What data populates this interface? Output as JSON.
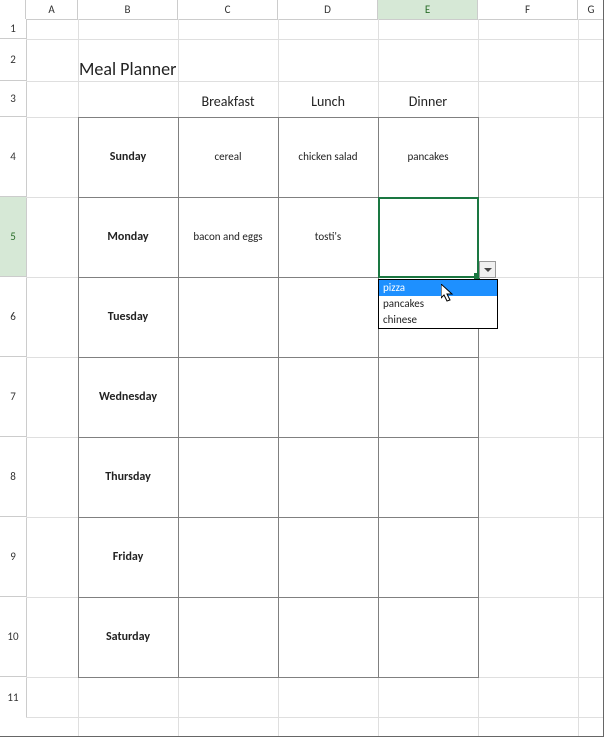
{
  "columns": {
    "A": {
      "label": "A",
      "width": 52
    },
    "B": {
      "label": "B",
      "width": 100
    },
    "C": {
      "label": "C",
      "width": 100
    },
    "D": {
      "label": "D",
      "width": 100
    },
    "E": {
      "label": "E",
      "width": 100
    },
    "F": {
      "label": "F",
      "width": 100
    },
    "G": {
      "label": "G",
      "width": 26
    }
  },
  "rows": {
    "1": 20,
    "2": 42,
    "3": 36,
    "4": 80,
    "5": 80,
    "6": 80,
    "7": 80,
    "8": 80,
    "9": 80,
    "10": 80,
    "11": 40
  },
  "title": "Meal Planner",
  "meal_columns": [
    "Breakfast",
    "Lunch",
    "Dinner"
  ],
  "days": [
    "Sunday",
    "Monday",
    "Tuesday",
    "Wednesday",
    "Thursday",
    "Friday",
    "Saturday"
  ],
  "cells": {
    "C4": "cereal",
    "D4": "chicken salad",
    "E4": "pancakes",
    "C5": "bacon and eggs",
    "D5": "tosti's",
    "E5": ""
  },
  "active_cell": "E5",
  "dropdown": {
    "options": [
      "pizza",
      "pancakes",
      "chinese"
    ],
    "highlighted_index": 0
  }
}
